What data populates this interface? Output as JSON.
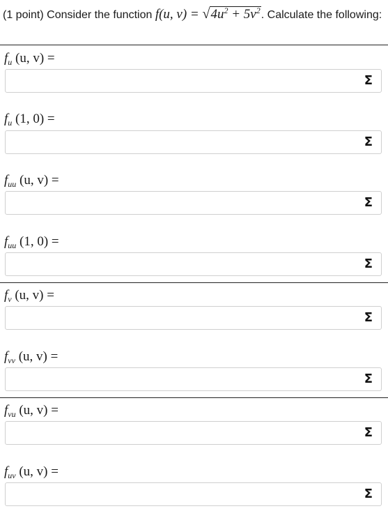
{
  "problem": {
    "points": "(1 point)",
    "lead": "Consider the function",
    "func_lhs": "f(u, v) = ",
    "radicand_a": "4u",
    "plus": " + 5v",
    "exp": "2",
    "tail": ". Calculate the following:"
  },
  "rows": [
    {
      "f": "f",
      "sub": "u",
      "args": "(u, v) =",
      "value": ""
    },
    {
      "f": "f",
      "sub": "u",
      "args": "(1, 0) =",
      "value": ""
    },
    {
      "f": "f",
      "sub": "uu",
      "args": "(u, v) =",
      "value": ""
    },
    {
      "f": "f",
      "sub": "uu",
      "args": "(1, 0) =",
      "value": ""
    },
    {
      "f": "f",
      "sub": "v",
      "args": "(u, v) =",
      "value": ""
    },
    {
      "f": "f",
      "sub": "vv",
      "args": "(u, v) =",
      "value": ""
    },
    {
      "f": "f",
      "sub": "vu",
      "args": "(u, v) =",
      "value": ""
    },
    {
      "f": "f",
      "sub": "uv",
      "args": "(u, v) =",
      "value": ""
    }
  ],
  "icon": {
    "sigma": "Σ",
    "name": "sigma-icon"
  }
}
